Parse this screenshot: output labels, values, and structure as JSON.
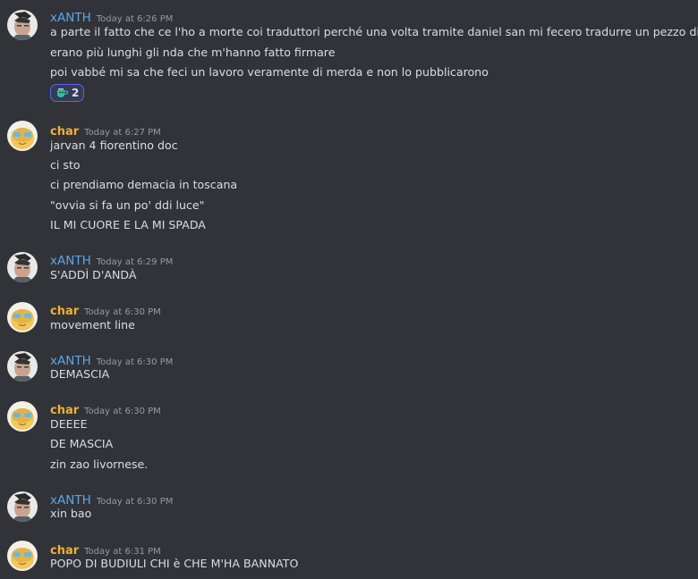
{
  "messages": [
    {
      "author": "xANTH",
      "timestamp": "Today at 6:26 PM",
      "lines": [
        "a parte il fatto che ce l'ho a morte coi traduttori perché una volta tramite daniel san mi fecero tradurre un pezzo di lore",
        "erano più lunghi gli nda che m'hanno fatto firmare",
        "poi vabbé mi sa che feci un lavoro veramente di merda e non lo pubblicarono"
      ],
      "reaction": {
        "emoji": "teacup-emoji",
        "count": "2"
      }
    },
    {
      "author": "char",
      "timestamp": "Today at 6:27 PM",
      "lines": [
        "jarvan 4 fiorentino doc",
        "ci sto",
        "ci prendiamo demacia in toscana",
        "\"ovvia si fa un po' ddi luce\"",
        "IL MI CUORE E LA MI SPADA"
      ]
    },
    {
      "author": "xANTH",
      "timestamp": "Today at 6:29 PM",
      "lines": [
        "S'ADDÌ D'ANDÀ"
      ]
    },
    {
      "author": "char",
      "timestamp": "Today at 6:30 PM",
      "lines": [
        "movement line"
      ]
    },
    {
      "author": "xANTH",
      "timestamp": "Today at 6:30 PM",
      "lines": [
        "DEMASCIA"
      ]
    },
    {
      "author": "char",
      "timestamp": "Today at 6:30 PM",
      "lines": [
        "DEEEE",
        "DE MASCIA",
        "zin zao livornese."
      ]
    },
    {
      "author": "xANTH",
      "timestamp": "Today at 6:30 PM",
      "lines": [
        "xin bao"
      ]
    },
    {
      "author": "char",
      "timestamp": "Today at 6:31 PM",
      "lines": [
        "POPO DI BUDIULI CHI è CHE M'HA BANNATO"
      ]
    }
  ],
  "colors": {
    "background": "#313338",
    "xanth_name": "#5aa6e8",
    "char_name": "#f0b132",
    "text": "#dbdee1",
    "timestamp": "#949ba4",
    "reaction_border": "#5865f2"
  }
}
